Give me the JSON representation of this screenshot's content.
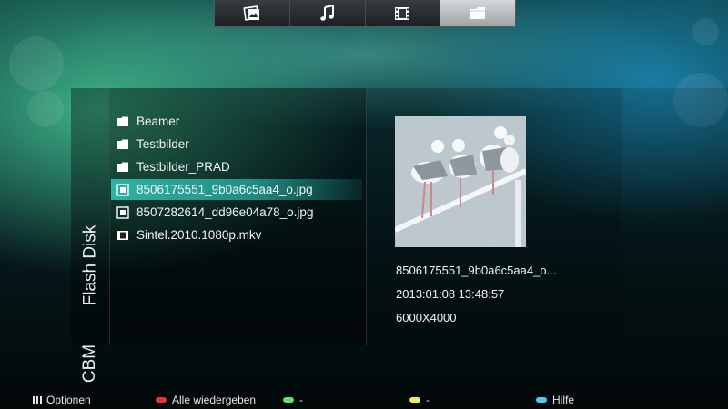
{
  "tabs": [
    {
      "name": "photos",
      "icon": "photo-icon",
      "active": false
    },
    {
      "name": "music",
      "icon": "music-note-icon",
      "active": false
    },
    {
      "name": "video",
      "icon": "film-icon",
      "active": false
    },
    {
      "name": "files",
      "icon": "folder-icon",
      "active": true
    }
  ],
  "sources": {
    "flash_disk": "Flash Disk",
    "cbm": "CBM"
  },
  "files": [
    {
      "label": "Beamer",
      "type": "folder",
      "icon": "folder-icon"
    },
    {
      "label": "Testbilder",
      "type": "folder",
      "icon": "folder-icon"
    },
    {
      "label": "Testbilder_PRAD",
      "type": "folder",
      "icon": "folder-icon"
    },
    {
      "label": "8506175551_9b0a6c5aa4_o.jpg",
      "type": "image",
      "icon": "image-file-icon",
      "selected": true
    },
    {
      "label": "8507282614_dd96e04a78_o.jpg",
      "type": "image",
      "icon": "image-file-icon"
    },
    {
      "label": "Sintel.2010.1080p.mkv",
      "type": "video",
      "icon": "video-file-icon"
    }
  ],
  "preview": {
    "filename": "8506175551_9b0a6c5aa4_o...",
    "datetime": "2013:01:08 13:48:57",
    "resolution": "6000X4000"
  },
  "bottom": {
    "options": "Optionen",
    "red": "Alle wiedergeben",
    "green": "-",
    "yellow": "-",
    "blue": "Hilfe"
  },
  "colors": {
    "red": "#e8323a",
    "green": "#5fe070",
    "yellow": "#f0e860",
    "blue": "#4fc8f0",
    "selection": "#2fb3a3"
  }
}
